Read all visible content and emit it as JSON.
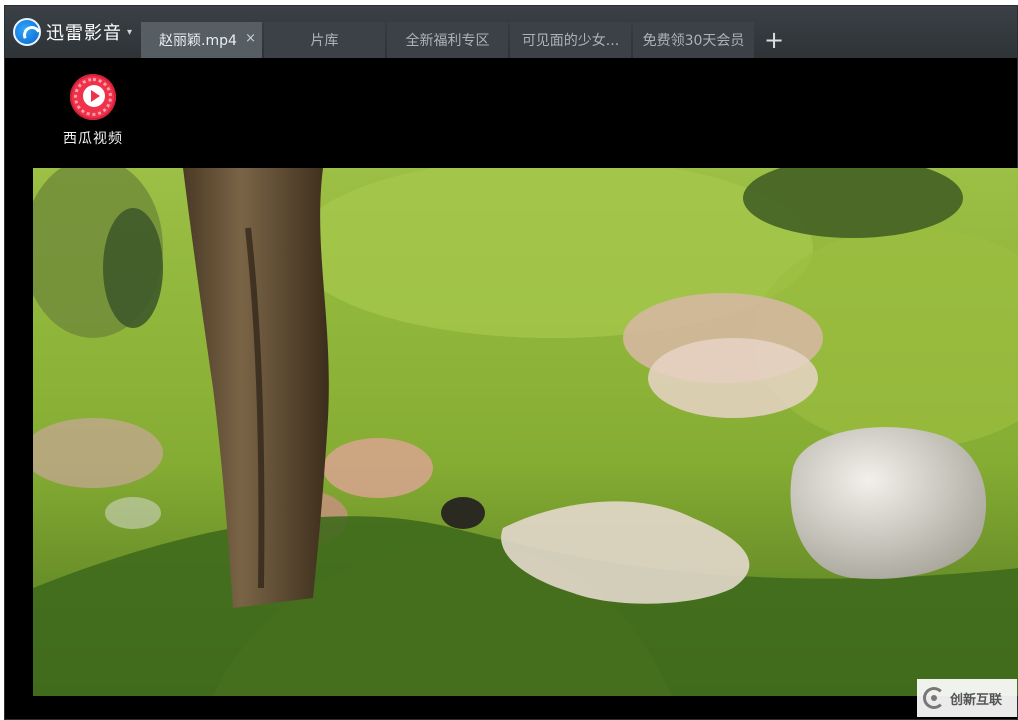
{
  "app": {
    "title": "迅雷影音",
    "caret": "▾"
  },
  "tabs": [
    {
      "label": "赵丽颖.mp4",
      "active": true,
      "close": "×"
    },
    {
      "label": "片库"
    },
    {
      "label": "全新福利专区"
    },
    {
      "label": "可见面的少女..."
    },
    {
      "label": "免费领30天会员"
    }
  ],
  "add_tab": "+",
  "video_watermark": {
    "icon": "play-circle-icon",
    "text": "西瓜视频"
  },
  "site_watermark": {
    "text": "创新互联"
  },
  "colors": {
    "titlebar": "#30363a",
    "active_tab": "#565e64",
    "tab": "#3b4146",
    "watermark_red": "#f0314a"
  }
}
